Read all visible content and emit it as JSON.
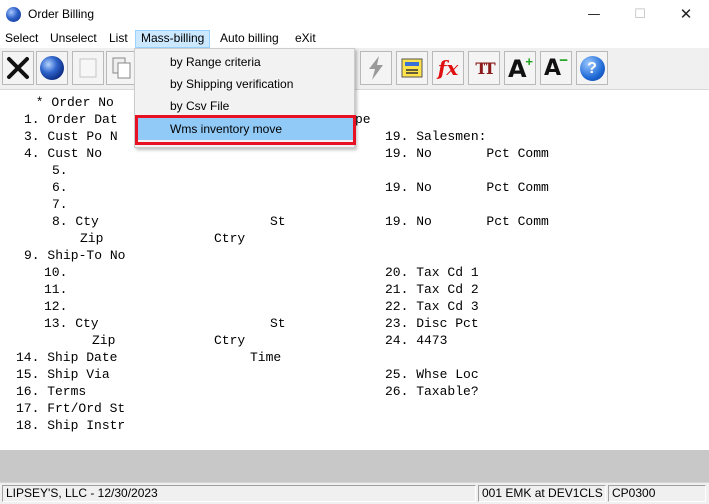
{
  "window": {
    "title": "Order Billing",
    "min_glyph": "—",
    "max_glyph": "☐",
    "close_glyph": "✕"
  },
  "menu": [
    {
      "label": "Select"
    },
    {
      "label": "Unselect"
    },
    {
      "label": "List"
    },
    {
      "label": "Mass-billing"
    },
    {
      "label": "Auto billing"
    },
    {
      "label": "eXit"
    }
  ],
  "toolbar": {
    "icons": [
      "exit-icon",
      "globe-icon",
      "blank-icon",
      "copy-icon",
      "lightning-icon",
      "calculator-icon",
      "fx-icon",
      "font-size-icon",
      "font-increase-icon",
      "font-decrease-icon",
      "help-icon"
    ],
    "fx_label": "fx",
    "tt_label": "TT",
    "a_label": "A",
    "help_label": "?"
  },
  "dropdown": {
    "items": [
      "by Range criteria",
      "by Shipping verification",
      "by Csv File",
      "Wms inventory move"
    ],
    "highlighted": "Wms inventory move"
  },
  "form": {
    "l0": " * Order No",
    "l1": "1. Order Dat",
    "l1b": "pe",
    "l3": "3. Cust Po N",
    "l4": "4. Cust No",
    "l5": "5.",
    "l6": "6.",
    "l7": "7.",
    "l8": "8. Cty",
    "l8st": "St",
    "l8zip": "Zip",
    "l8ctry": "Ctry",
    "l9": "9. Ship-To No",
    "l10": "10.",
    "l11": "11.",
    "l12": "12.",
    "l13": "13. Cty",
    "l13st": "St",
    "l13zip": "Zip",
    "l13ctry": "Ctry",
    "l14": "14. Ship Date",
    "l14time": "Time",
    "l15": "15. Ship Via",
    "l16": "16. Terms",
    "l17": "17. Frt/Ord St",
    "l18": "18. Ship Instr",
    "r19a": "19. Salesmen:",
    "r19b": "19. No       Pct Comm",
    "r19c": "19. No       Pct Comm",
    "r19d": "19. No       Pct Comm",
    "r20": "20. Tax Cd 1",
    "r21": "21. Tax Cd 2",
    "r22": "22. Tax Cd 3",
    "r23": "23. Disc Pct",
    "r24": "24. 4473",
    "r25": "25. Whse Loc",
    "r26": "26. Taxable?"
  },
  "status": {
    "company": "LIPSEY'S, LLC - 12/30/2023",
    "user": "001 EMK at DEV1CLS",
    "program": "CP0300"
  },
  "colors": {
    "menu_highlight": "#cce8ff",
    "dropdown_highlight": "#91c9f7",
    "annotation_box": "#e81123"
  }
}
